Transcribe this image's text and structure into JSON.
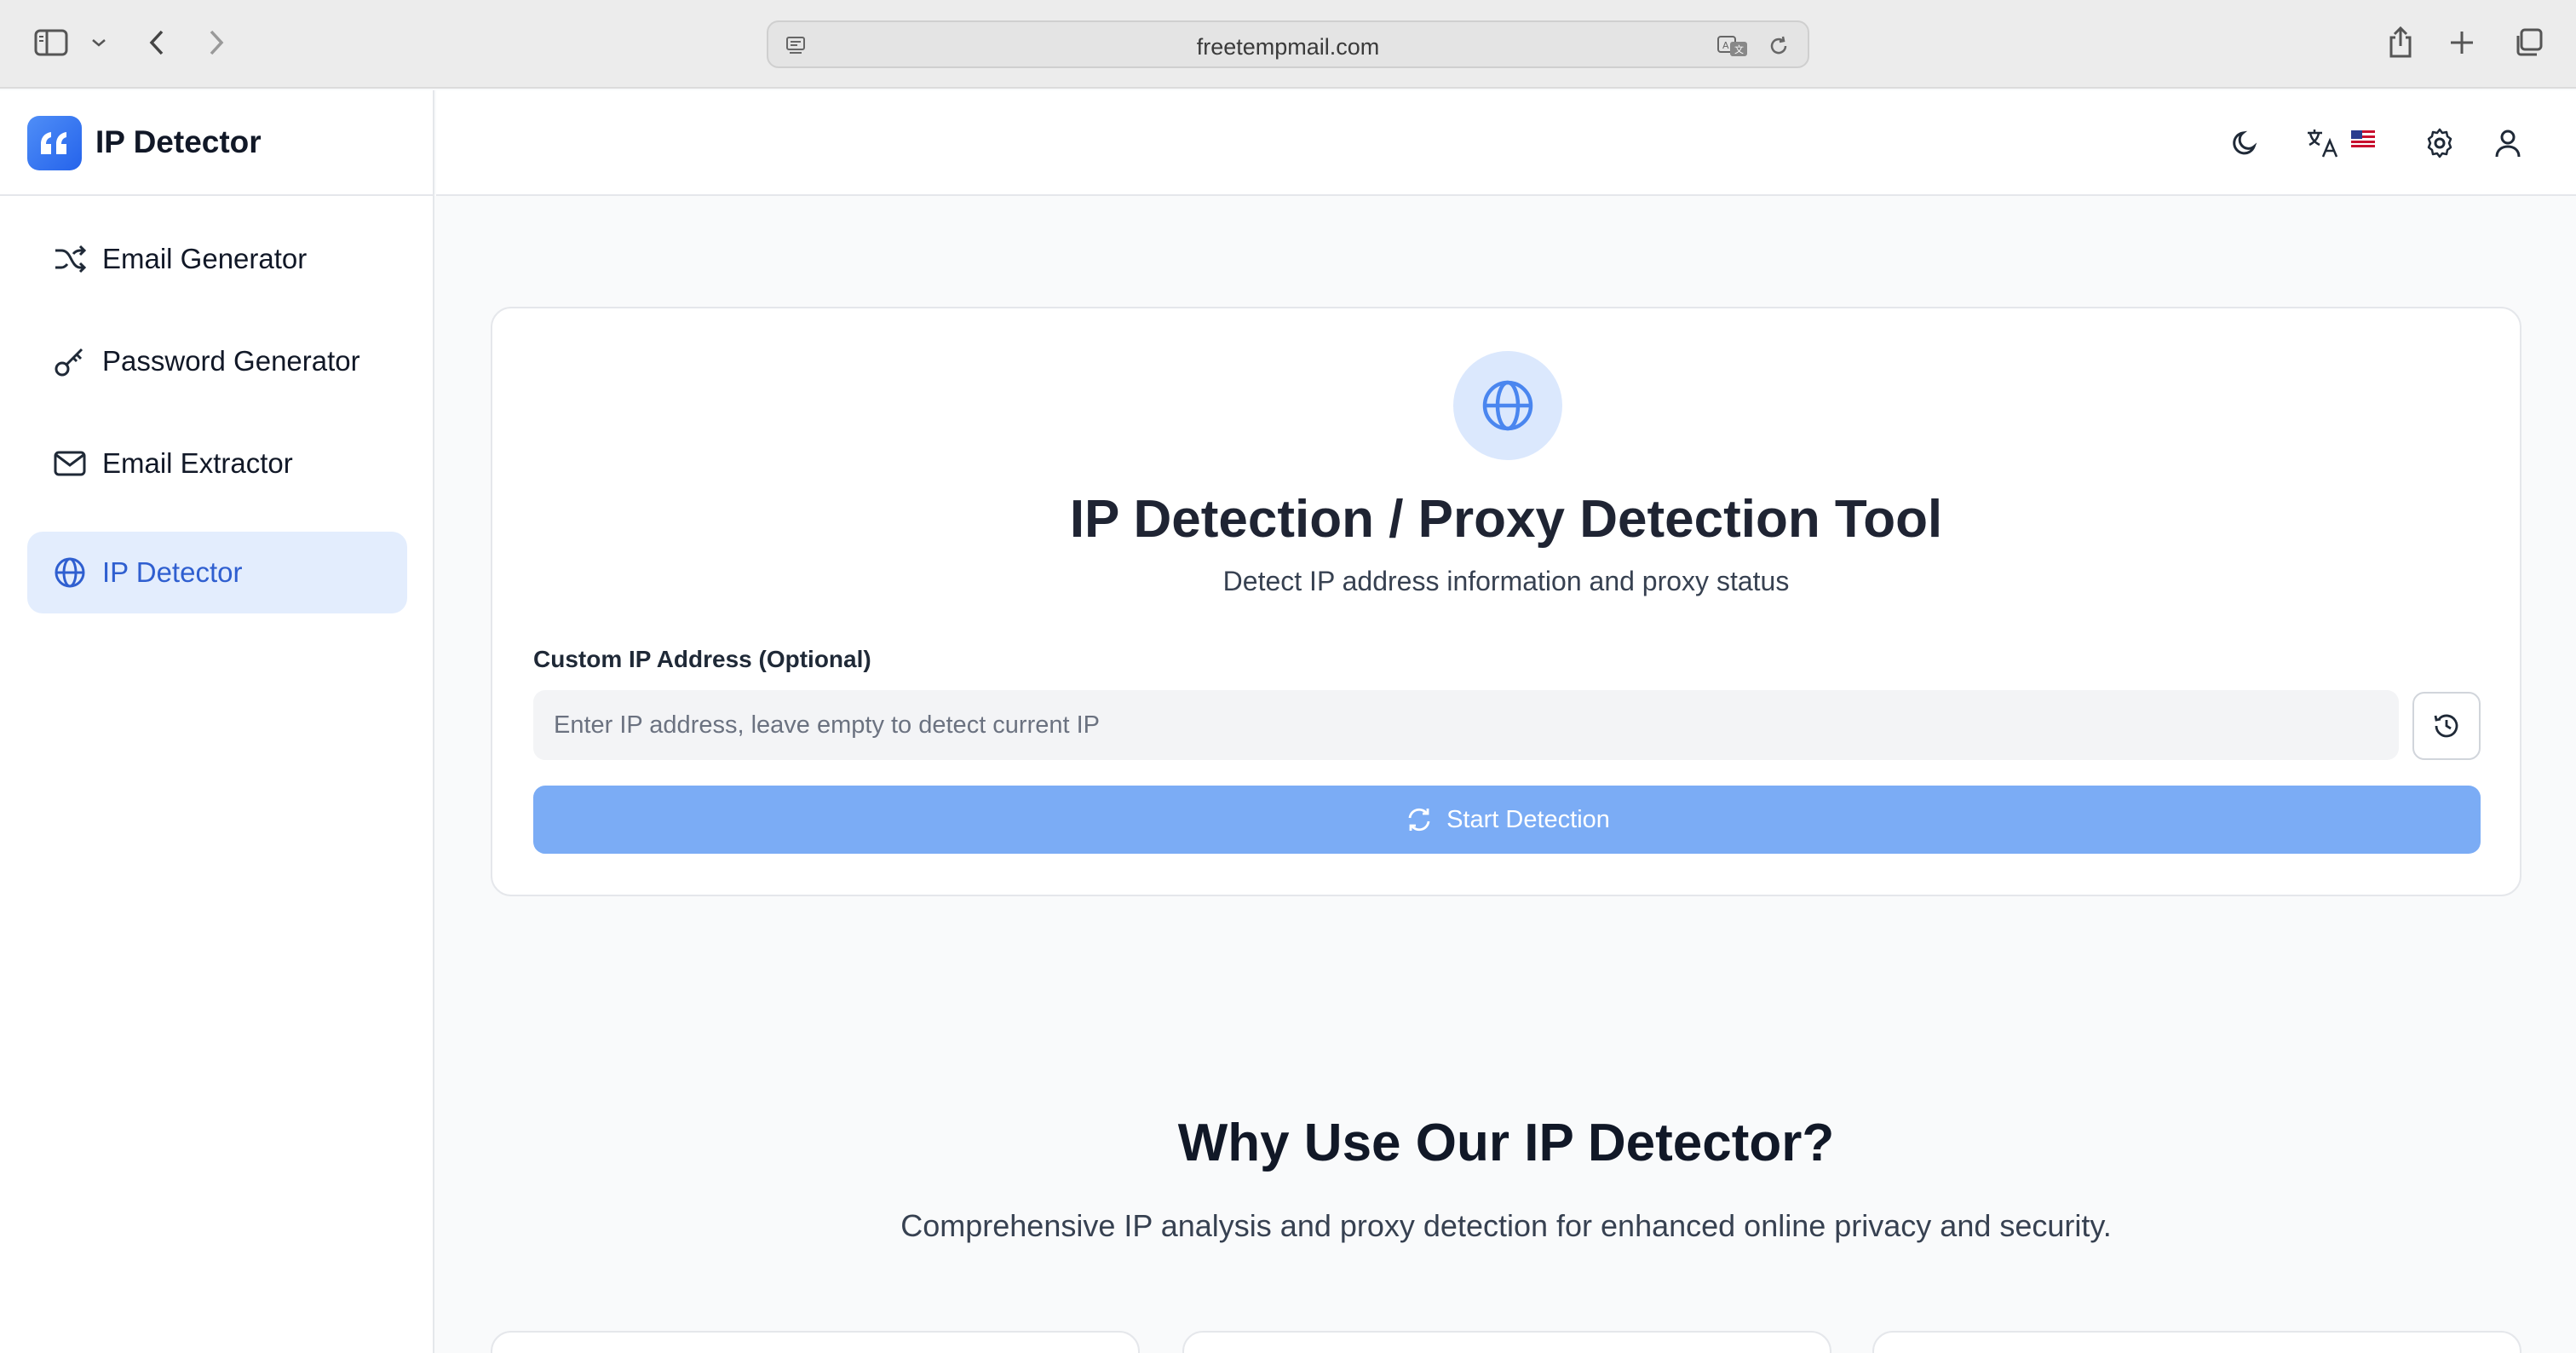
{
  "browser": {
    "url": "freetempmail.com",
    "icons": [
      "sidebar-icon",
      "chevron-down-icon",
      "back-icon",
      "forward-icon",
      "page-icon",
      "translate-icon",
      "reload-icon",
      "share-icon",
      "plus-icon",
      "tabs-icon"
    ]
  },
  "sidebar": {
    "brand_name": "IP Detector",
    "items": [
      {
        "label": "Email Generator",
        "icon": "shuffle-icon"
      },
      {
        "label": "Password Generator",
        "icon": "key-icon"
      },
      {
        "label": "Email Extractor",
        "icon": "mail-icon"
      },
      {
        "label": "IP Detector",
        "icon": "globe-icon",
        "active": true
      }
    ]
  },
  "header": {
    "icons": [
      "moon-icon",
      "language-icon",
      "us-flag-icon",
      "settings-icon",
      "user-icon"
    ]
  },
  "tool": {
    "title": "IP Detection / Proxy Detection Tool",
    "subtitle": "Detect IP address information and proxy status",
    "field_label": "Custom IP Address (Optional)",
    "input_value": "",
    "input_placeholder": "Enter IP address, leave empty to detect current IP",
    "start_label": "Start Detection"
  },
  "why": {
    "title": "Why Use Our IP Detector?",
    "subtitle": "Comprehensive IP analysis and proxy detection for enhanced online privacy and security."
  },
  "colors": {
    "accent": "#2f5fd0",
    "active_bg": "#e3edfd",
    "button_bg": "#7bacf5"
  }
}
